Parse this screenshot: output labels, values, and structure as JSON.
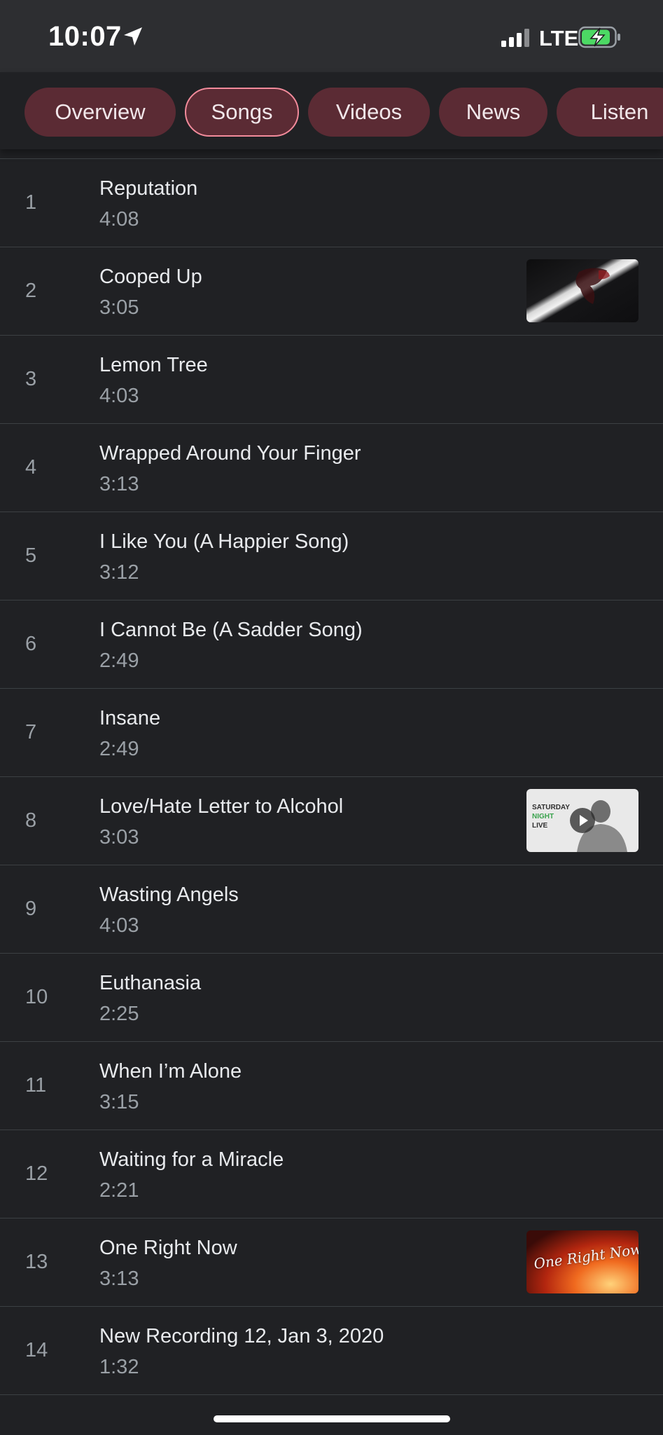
{
  "status_bar": {
    "time": "10:07",
    "network": "LTE",
    "location_icon": "location-arrow-icon",
    "signal_icon": "cellular-signal-icon",
    "battery_icon": "battery-charging-icon"
  },
  "tabs": [
    {
      "label": "Overview",
      "active": false
    },
    {
      "label": "Songs",
      "active": true
    },
    {
      "label": "Videos",
      "active": false
    },
    {
      "label": "News",
      "active": false
    },
    {
      "label": "Listen",
      "active": false
    }
  ],
  "songs": [
    {
      "number": "1",
      "title": "Reputation",
      "duration": "4:08"
    },
    {
      "number": "2",
      "title": "Cooped Up",
      "duration": "3:05",
      "thumbnail": "video-thumbnail"
    },
    {
      "number": "3",
      "title": "Lemon Tree",
      "duration": "4:03"
    },
    {
      "number": "4",
      "title": "Wrapped Around Your Finger",
      "duration": "3:13"
    },
    {
      "number": "5",
      "title": "I Like You (A Happier Song)",
      "duration": "3:12"
    },
    {
      "number": "6",
      "title": "I Cannot Be (A Sadder Song)",
      "duration": "2:49"
    },
    {
      "number": "7",
      "title": "Insane",
      "duration": "2:49"
    },
    {
      "number": "8",
      "title": "Love/Hate Letter to Alcohol",
      "duration": "3:03",
      "thumbnail": "video-thumbnail",
      "thumbnail_text": [
        "SATURDAY",
        "NIGHT",
        "LIVE"
      ]
    },
    {
      "number": "9",
      "title": "Wasting Angels",
      "duration": "4:03"
    },
    {
      "number": "10",
      "title": "Euthanasia",
      "duration": "2:25"
    },
    {
      "number": "11",
      "title": "When I’m Alone",
      "duration": "3:15"
    },
    {
      "number": "12",
      "title": "Waiting for a Miracle",
      "duration": "2:21"
    },
    {
      "number": "13",
      "title": "One Right Now",
      "duration": "3:13",
      "thumbnail": "video-thumbnail",
      "thumbnail_text": "One Right Now"
    },
    {
      "number": "14",
      "title": "New Recording 12, Jan 3, 2020",
      "duration": "1:32"
    }
  ],
  "colors": {
    "background": "#202124",
    "status_bar": "#2d2e31",
    "tab_fill": "#5b2b34",
    "active_tab_border": "#f28b9b",
    "divider": "#3c4043"
  }
}
